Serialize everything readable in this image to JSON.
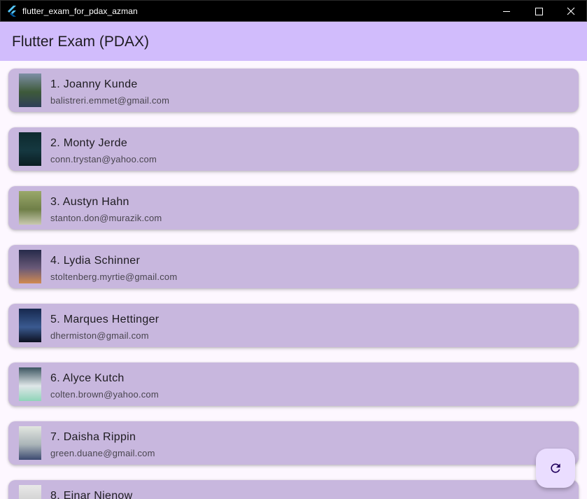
{
  "window": {
    "title": "flutter_exam_for_pdax_azman"
  },
  "appbar": {
    "title": "Flutter Exam (PDAX)"
  },
  "users": [
    {
      "name": "1. Joanny Kunde",
      "email": "balistreri.emmet@gmail.com",
      "thumb_colors": [
        "#7d8fa6",
        "#3e5a3a",
        "#2e3f58"
      ]
    },
    {
      "name": "2. Monty Jerde",
      "email": "conn.trystan@yahoo.com",
      "thumb_colors": [
        "#0d2a2e",
        "#153840",
        "#0a1d22"
      ]
    },
    {
      "name": "3. Austyn Hahn",
      "email": "stanton.don@murazik.com",
      "thumb_colors": [
        "#9aa86a",
        "#6f7f48",
        "#c8c9b0"
      ]
    },
    {
      "name": "4. Lydia Schinner",
      "email": "stoltenberg.myrtie@gmail.com",
      "thumb_colors": [
        "#262a4a",
        "#6a5a78",
        "#d08a50"
      ]
    },
    {
      "name": "5. Marques Hettinger",
      "email": "dhermiston@gmail.com",
      "thumb_colors": [
        "#16284e",
        "#3a5a90",
        "#0c1020"
      ]
    },
    {
      "name": "6. Alyce Kutch",
      "email": "colten.brown@yahoo.com",
      "thumb_colors": [
        "#3c5560",
        "#dfe6e8",
        "#8fd4b8"
      ]
    },
    {
      "name": "7. Daisha Rippin",
      "email": "green.duane@gmail.com",
      "thumb_colors": [
        "#e2e6e0",
        "#aab4b8",
        "#3c4a70"
      ]
    },
    {
      "name": "8. Einar Nienow",
      "email": "",
      "thumb_colors": [
        "#e8e8e8",
        "#cfcfcf",
        "#b0b0b0"
      ]
    }
  ],
  "fab": {
    "icon": "refresh-icon"
  }
}
